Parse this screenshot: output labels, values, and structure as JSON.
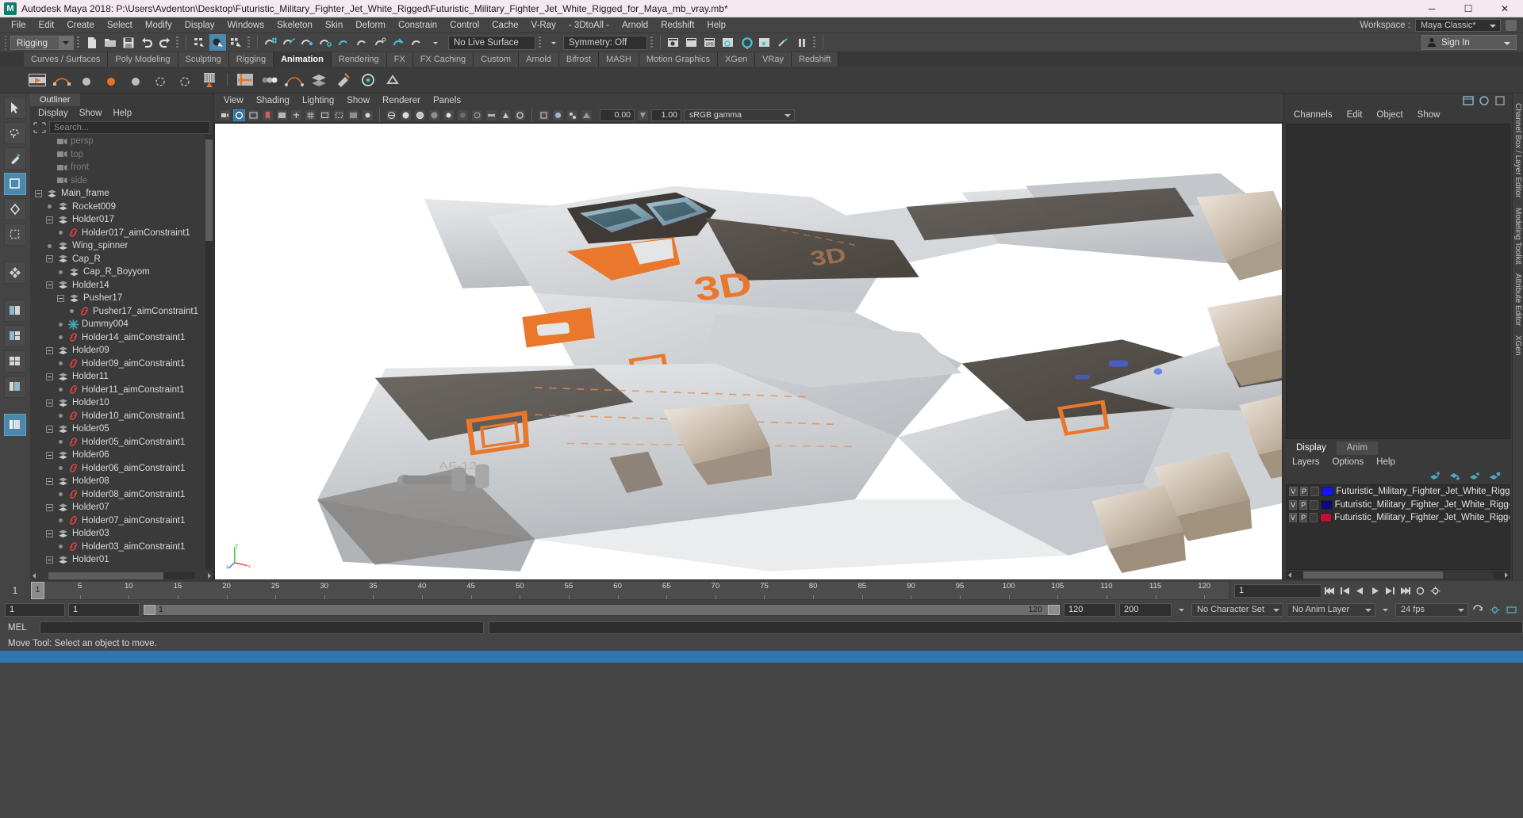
{
  "window": {
    "app_icon": "M",
    "title": "Autodesk Maya 2018: P:\\Users\\Avdenton\\Desktop\\Futuristic_Military_Fighter_Jet_White_Rigged\\Futuristic_Military_Fighter_Jet_White_Rigged_for_Maya_mb_vray.mb*",
    "minimize": "─",
    "maximize": "☐",
    "close": "✕"
  },
  "menubar": {
    "items": [
      "File",
      "Edit",
      "Create",
      "Select",
      "Modify",
      "Display",
      "Windows",
      "Skeleton",
      "Skin",
      "Deform",
      "Constrain",
      "Control",
      "Cache",
      "V-Ray",
      "- 3DtoAll -",
      "Arnold",
      "Redshift",
      "Help"
    ],
    "workspace_label": "Workspace :",
    "workspace_value": "Maya Classic*"
  },
  "toolbar": {
    "menuset": "Rigging",
    "live_surface": "No Live Surface",
    "symmetry": "Symmetry: Off",
    "signin": "Sign In"
  },
  "shelf": {
    "tabs": [
      "Curves / Surfaces",
      "Poly Modeling",
      "Sculpting",
      "Rigging",
      "Animation",
      "Rendering",
      "FX",
      "FX Caching",
      "Custom",
      "Arnold",
      "Bifrost",
      "MASH",
      "Motion Graphics",
      "XGen",
      "VRay",
      "Redshift"
    ],
    "selected": "Animation"
  },
  "outliner": {
    "tab": "Outliner",
    "menu": [
      "Display",
      "Show",
      "Help"
    ],
    "search_placeholder": "Search...",
    "rows": [
      {
        "label": "persp",
        "icon": "camera-icon",
        "depth": 2,
        "kind": "cam",
        "expander": "none"
      },
      {
        "label": "top",
        "icon": "camera-icon",
        "depth": 2,
        "kind": "cam",
        "expander": "none"
      },
      {
        "label": "front",
        "icon": "camera-icon",
        "depth": 2,
        "kind": "cam",
        "expander": "none"
      },
      {
        "label": "side",
        "icon": "camera-icon",
        "depth": 2,
        "kind": "cam",
        "expander": "none"
      },
      {
        "label": "Main_frame",
        "icon": "transform-icon",
        "depth": 1,
        "kind": "xform",
        "expander": "minus"
      },
      {
        "label": "Rocket009",
        "icon": "transform-icon",
        "depth": 2,
        "kind": "xform",
        "expander": "dot"
      },
      {
        "label": "Holder017",
        "icon": "transform-icon",
        "depth": 2,
        "kind": "xform",
        "expander": "minus"
      },
      {
        "label": "Holder017_aimConstraint1",
        "icon": "constraint-icon",
        "depth": 3,
        "kind": "constraint",
        "expander": "dot"
      },
      {
        "label": "Wing_spinner",
        "icon": "transform-icon",
        "depth": 2,
        "kind": "xform",
        "expander": "dot"
      },
      {
        "label": "Cap_R",
        "icon": "transform-icon",
        "depth": 2,
        "kind": "xform",
        "expander": "minus"
      },
      {
        "label": "Cap_R_Boyyom",
        "icon": "transform-icon",
        "depth": 3,
        "kind": "xform",
        "expander": "dot"
      },
      {
        "label": "Holder14",
        "icon": "transform-icon",
        "depth": 2,
        "kind": "xform",
        "expander": "minus"
      },
      {
        "label": "Pusher17",
        "icon": "transform-icon",
        "depth": 3,
        "kind": "xform",
        "expander": "minus"
      },
      {
        "label": "Pusher17_aimConstraint1",
        "icon": "constraint-icon",
        "depth": 4,
        "kind": "constraint",
        "expander": "dot"
      },
      {
        "label": "Dummy004",
        "icon": "locator-icon",
        "depth": 3,
        "kind": "locator",
        "expander": "dot"
      },
      {
        "label": "Holder14_aimConstraint1",
        "icon": "constraint-icon",
        "depth": 3,
        "kind": "constraint",
        "expander": "dot"
      },
      {
        "label": "Holder09",
        "icon": "transform-icon",
        "depth": 2,
        "kind": "xform",
        "expander": "minus"
      },
      {
        "label": "Holder09_aimConstraint1",
        "icon": "constraint-icon",
        "depth": 3,
        "kind": "constraint",
        "expander": "dot"
      },
      {
        "label": "Holder11",
        "icon": "transform-icon",
        "depth": 2,
        "kind": "xform",
        "expander": "minus"
      },
      {
        "label": "Holder11_aimConstraint1",
        "icon": "constraint-icon",
        "depth": 3,
        "kind": "constraint",
        "expander": "dot"
      },
      {
        "label": "Holder10",
        "icon": "transform-icon",
        "depth": 2,
        "kind": "xform",
        "expander": "minus"
      },
      {
        "label": "Holder10_aimConstraint1",
        "icon": "constraint-icon",
        "depth": 3,
        "kind": "constraint",
        "expander": "dot"
      },
      {
        "label": "Holder05",
        "icon": "transform-icon",
        "depth": 2,
        "kind": "xform",
        "expander": "minus"
      },
      {
        "label": "Holder05_aimConstraint1",
        "icon": "constraint-icon",
        "depth": 3,
        "kind": "constraint",
        "expander": "dot"
      },
      {
        "label": "Holder06",
        "icon": "transform-icon",
        "depth": 2,
        "kind": "xform",
        "expander": "minus"
      },
      {
        "label": "Holder06_aimConstraint1",
        "icon": "constraint-icon",
        "depth": 3,
        "kind": "constraint",
        "expander": "dot"
      },
      {
        "label": "Holder08",
        "icon": "transform-icon",
        "depth": 2,
        "kind": "xform",
        "expander": "minus"
      },
      {
        "label": "Holder08_aimConstraint1",
        "icon": "constraint-icon",
        "depth": 3,
        "kind": "constraint",
        "expander": "dot"
      },
      {
        "label": "Holder07",
        "icon": "transform-icon",
        "depth": 2,
        "kind": "xform",
        "expander": "minus"
      },
      {
        "label": "Holder07_aimConstraint1",
        "icon": "constraint-icon",
        "depth": 3,
        "kind": "constraint",
        "expander": "dot"
      },
      {
        "label": "Holder03",
        "icon": "transform-icon",
        "depth": 2,
        "kind": "xform",
        "expander": "minus"
      },
      {
        "label": "Holder03_aimConstraint1",
        "icon": "constraint-icon",
        "depth": 3,
        "kind": "constraint",
        "expander": "dot"
      },
      {
        "label": "Holder01",
        "icon": "transform-icon",
        "depth": 2,
        "kind": "xform",
        "expander": "minus"
      }
    ]
  },
  "viewport": {
    "menu": [
      "View",
      "Shading",
      "Lighting",
      "Show",
      "Renderer",
      "Panels"
    ],
    "exposure": "0.00",
    "gamma_value": "1.00",
    "color_space": "sRGB gamma",
    "axis": {
      "x": "x",
      "y": "y",
      "z": "z"
    }
  },
  "rightdock": {
    "menu": [
      "Channels",
      "Edit",
      "Object",
      "Show"
    ],
    "edge_tabs": [
      "Channel Box / Layer Editor",
      "Modeling Toolkit",
      "Attribute Editor",
      "XGen"
    ],
    "layer_tabs": [
      "Display",
      "Anim"
    ],
    "layer_tab_selected": "Display",
    "layer_menu": [
      "Layers",
      "Options",
      "Help"
    ],
    "layers": [
      {
        "v": "V",
        "p": "P",
        "color": "#1414ff",
        "name": "Futuristic_Military_Fighter_Jet_White_Rigged_Hel"
      },
      {
        "v": "V",
        "p": "P",
        "color": "#0a0a78",
        "name": "Futuristic_Military_Fighter_Jet_White_Rigged_Geom"
      },
      {
        "v": "V",
        "p": "P",
        "color": "#c20d35",
        "name": "Futuristic_Military_Fighter_Jet_White_Rigged_Contro"
      }
    ]
  },
  "timeslider": {
    "start_label": "1",
    "ticks": [
      "5",
      "10",
      "15",
      "20",
      "25",
      "30",
      "35",
      "40",
      "45",
      "50",
      "55",
      "60",
      "65",
      "70",
      "75",
      "80",
      "85",
      "90",
      "95",
      "100",
      "105",
      "110",
      "115",
      "120"
    ],
    "current_frame": "1",
    "current_marker": "1"
  },
  "rangeslider": {
    "anim_start": "1",
    "range_start": "1",
    "range_track_start": "1",
    "range_track_end": "120",
    "range_end": "120",
    "anim_end": "200",
    "character_set": "No Character Set",
    "anim_layer": "No Anim Layer",
    "fps": "24 fps"
  },
  "mel": {
    "label": "MEL",
    "value": ""
  },
  "statusbar": {
    "message": "Move Tool: Select an object to move."
  }
}
